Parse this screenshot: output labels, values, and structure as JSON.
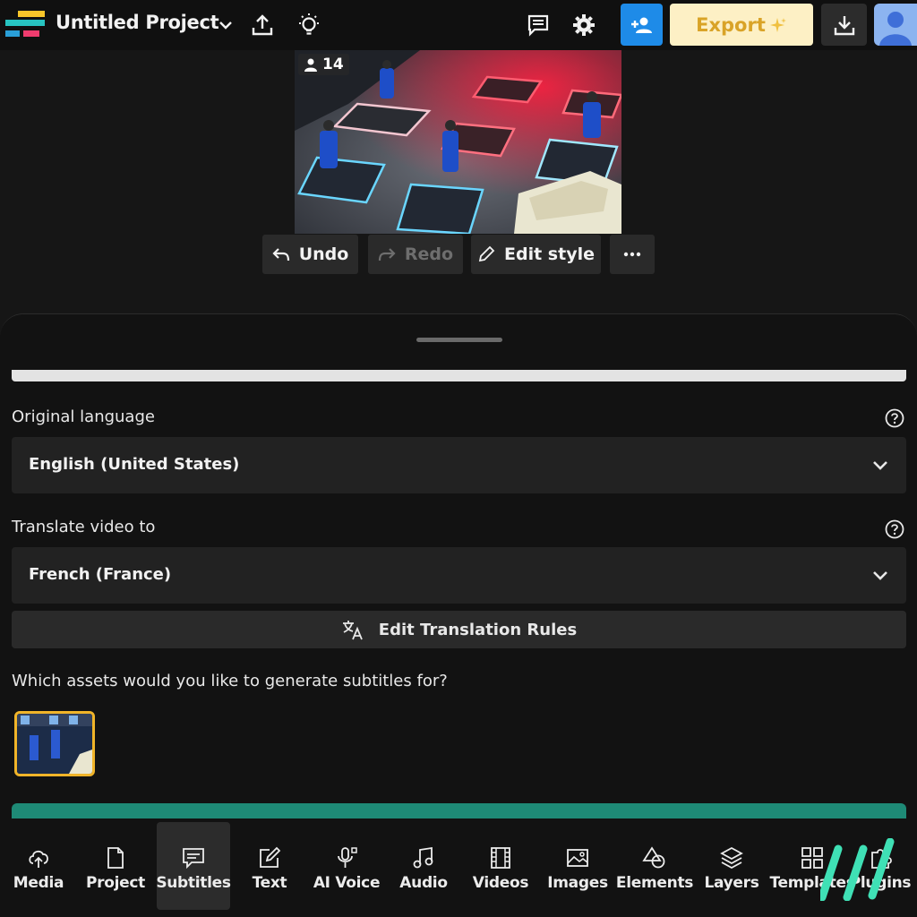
{
  "header": {
    "project_title": "Untitled Project",
    "export_label": "Export",
    "accent_blue": "#1e8be8",
    "export_bg": "#fdf0c5",
    "export_text": "#d9a327"
  },
  "canvas": {
    "viewer_count": "14"
  },
  "edit_toolbar": {
    "undo_label": "Undo",
    "redo_label": "Redo",
    "edit_style_label": "Edit style"
  },
  "subtitles_panel": {
    "original_language_label": "Original language",
    "original_language_value": "English (United States)",
    "translate_label": "Translate video to",
    "translate_value": "French (France)",
    "translation_rules_label": "Edit Translation Rules",
    "assets_question": "Which assets would you like to generate subtitles for?",
    "generate_color": "#1e8a76"
  },
  "bottom_nav": {
    "items": [
      {
        "label": "Media",
        "icon": "upload-cloud-icon"
      },
      {
        "label": "Project",
        "icon": "file-icon"
      },
      {
        "label": "Subtitles",
        "icon": "subtitles-icon",
        "active": true
      },
      {
        "label": "Text",
        "icon": "edit-text-icon"
      },
      {
        "label": "AI Voice",
        "icon": "microphone-icon"
      },
      {
        "label": "Audio",
        "icon": "music-note-icon"
      },
      {
        "label": "Videos",
        "icon": "film-icon"
      },
      {
        "label": "Images",
        "icon": "image-icon"
      },
      {
        "label": "Elements",
        "icon": "shapes-icon"
      },
      {
        "label": "Layers",
        "icon": "layers-icon"
      },
      {
        "label": "Templates",
        "icon": "grid-icon"
      },
      {
        "label": "Plugins",
        "icon": "plugin-icon"
      }
    ]
  }
}
